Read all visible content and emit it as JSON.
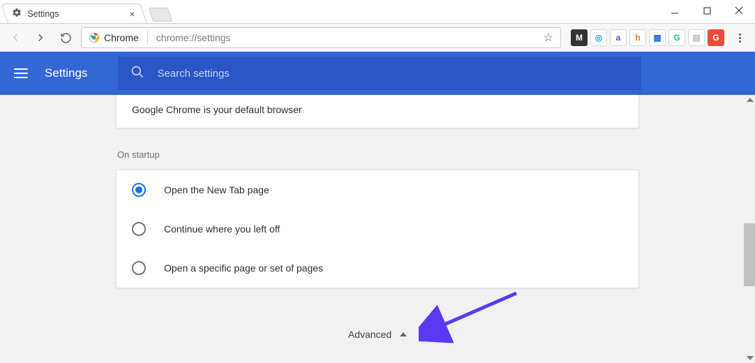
{
  "window": {
    "tab_title": "Settings"
  },
  "toolbar": {
    "chrome_label": "Chrome",
    "url": "chrome://settings"
  },
  "ext_icons": [
    {
      "letter": "M",
      "bg": "#333333",
      "fg": "#ffffff"
    },
    {
      "letter": "◎",
      "bg": "#ffffff",
      "fg": "#1a9ee5"
    },
    {
      "letter": "a",
      "bg": "#ffffff",
      "fg": "#3b5cc4"
    },
    {
      "letter": "h",
      "bg": "#ffffff",
      "fg": "#ff7a18"
    },
    {
      "letter": "▦",
      "bg": "#ffffff",
      "fg": "#2b6ed4"
    },
    {
      "letter": "G",
      "bg": "#ffffff",
      "fg": "#15c39a"
    },
    {
      "letter": "▤",
      "bg": "#ffffff",
      "fg": "#b9b9b9"
    },
    {
      "letter": "G",
      "bg": "#e74c3c",
      "fg": "#ffffff"
    }
  ],
  "settings_bar": {
    "title": "Settings",
    "search_placeholder": "Search settings"
  },
  "default_browser_card": {
    "text": "Google Chrome is your default browser"
  },
  "startup": {
    "section_label": "On startup",
    "options": [
      {
        "label": "Open the New Tab page",
        "selected": true
      },
      {
        "label": "Continue where you left off",
        "selected": false
      },
      {
        "label": "Open a specific page or set of pages",
        "selected": false
      }
    ]
  },
  "advanced": {
    "label": "Advanced"
  }
}
